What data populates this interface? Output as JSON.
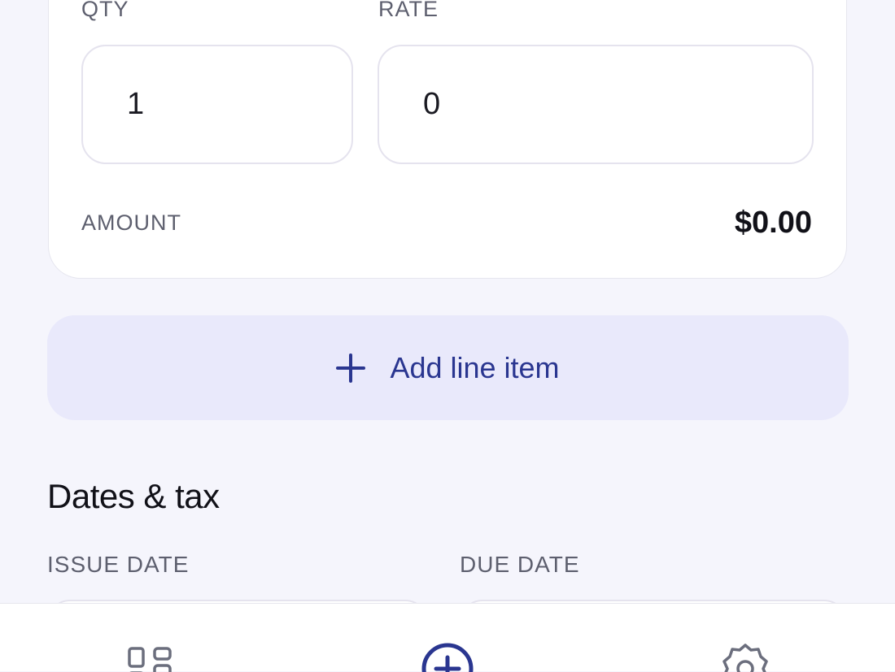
{
  "line_item": {
    "qty_label": "QTY",
    "qty_value": "1",
    "rate_label": "RATE",
    "rate_value": "0",
    "amount_label": "AMOUNT",
    "amount_value": "$0.00"
  },
  "add_line_item_label": "Add line item",
  "dates_section": {
    "title": "Dates & tax",
    "issue_date_label": "ISSUE DATE",
    "due_date_label": "DUE DATE"
  },
  "bottom_nav": {
    "items": [
      {
        "icon": "dashboard-icon"
      },
      {
        "icon": "add-circle-icon"
      },
      {
        "icon": "gear-icon"
      }
    ]
  },
  "colors": {
    "background": "#F5F5FC",
    "accent": "#2A3690",
    "accent_soft": "#E9E9FB",
    "label": "#5D5F6E"
  }
}
